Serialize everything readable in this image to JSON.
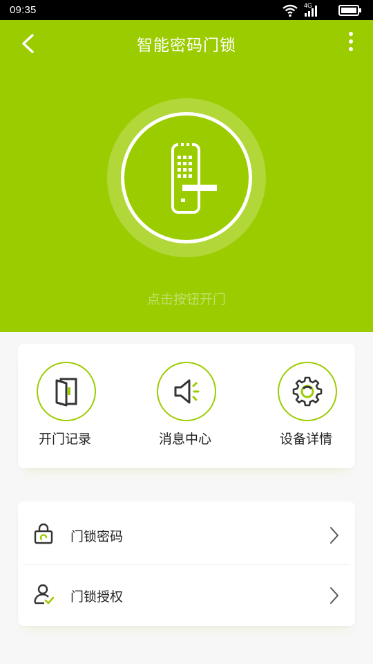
{
  "status_bar": {
    "time": "09:35",
    "network": "4G"
  },
  "header": {
    "title": "智能密码门锁"
  },
  "hero": {
    "hint": "点击按钮开门"
  },
  "quick_actions": [
    {
      "label": "开门记录",
      "icon": "door-open-icon"
    },
    {
      "label": "消息中心",
      "icon": "speaker-icon"
    },
    {
      "label": "设备详情",
      "icon": "gear-icon"
    }
  ],
  "list": [
    {
      "label": "门锁密码",
      "icon": "lock-icon"
    },
    {
      "label": "门锁授权",
      "icon": "user-auth-icon"
    }
  ],
  "colors": {
    "primary": "#9bcc00",
    "status_bar": "#000000",
    "text": "#222222"
  }
}
